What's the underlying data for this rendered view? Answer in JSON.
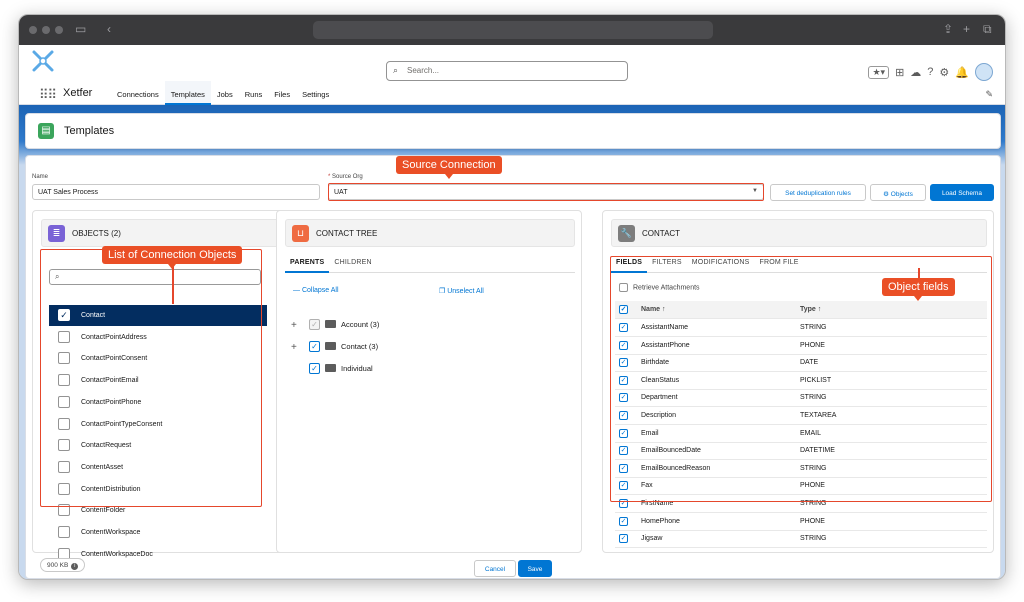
{
  "header": {
    "search_placeholder": "Search...",
    "app_name": "Xetfer",
    "nav": [
      "Connections",
      "Templates",
      "Jobs",
      "Runs",
      "Files",
      "Settings"
    ],
    "active_nav": "Templates"
  },
  "page": {
    "title": "Templates"
  },
  "form": {
    "name_label": "Name",
    "name_value": "UAT Sales Process",
    "source_label": "Source Org",
    "source_required": "*",
    "source_value": "UAT",
    "btn_dedup": "Set deduplication rules",
    "btn_objects": "Objects",
    "btn_load": "Load Schema"
  },
  "callouts": {
    "source": "Source Connection",
    "objects": "List of Connection Objects",
    "fields": "Object fields"
  },
  "objects_panel": {
    "title": "OBJECTS  (2)",
    "items": [
      "Contact",
      "ContactPointAddress",
      "ContactPointConsent",
      "ContactPointEmail",
      "ContactPointPhone",
      "ContactPointTypeConsent",
      "ContactRequest",
      "ContentAsset",
      "ContentDistribution",
      "ContentFolder",
      "ContentWorkspace",
      "ContentWorkspaceDoc"
    ],
    "selected": "Contact"
  },
  "tree_panel": {
    "title": "CONTACT TREE",
    "tabs": [
      "PARENTS",
      "CHILDREN"
    ],
    "collapse": "Collapse All",
    "unselect": "Unselect All",
    "nodes": [
      "Account (3)",
      "Contact (3)",
      "Individual"
    ]
  },
  "contact_panel": {
    "title": "CONTACT",
    "tabs": [
      "FIELDS",
      "FILTERS",
      "MODIFICATIONS",
      "FROM FILE"
    ],
    "retrieve": "Retrieve Attachments",
    "col_name": "Name",
    "col_type": "Type",
    "rows": [
      [
        "AssistantName",
        "STRING"
      ],
      [
        "AssistantPhone",
        "PHONE"
      ],
      [
        "Birthdate",
        "DATE"
      ],
      [
        "CleanStatus",
        "PICKLIST"
      ],
      [
        "Department",
        "STRING"
      ],
      [
        "Description",
        "TEXTAREA"
      ],
      [
        "Email",
        "EMAIL"
      ],
      [
        "EmailBouncedDate",
        "DATETIME"
      ],
      [
        "EmailBouncedReason",
        "STRING"
      ],
      [
        "Fax",
        "PHONE"
      ],
      [
        "FirstName",
        "STRING"
      ],
      [
        "HomePhone",
        "PHONE"
      ],
      [
        "Jigsaw",
        "STRING"
      ]
    ]
  },
  "footer": {
    "size": "900 KB",
    "cancel": "Cancel",
    "save": "Save"
  }
}
